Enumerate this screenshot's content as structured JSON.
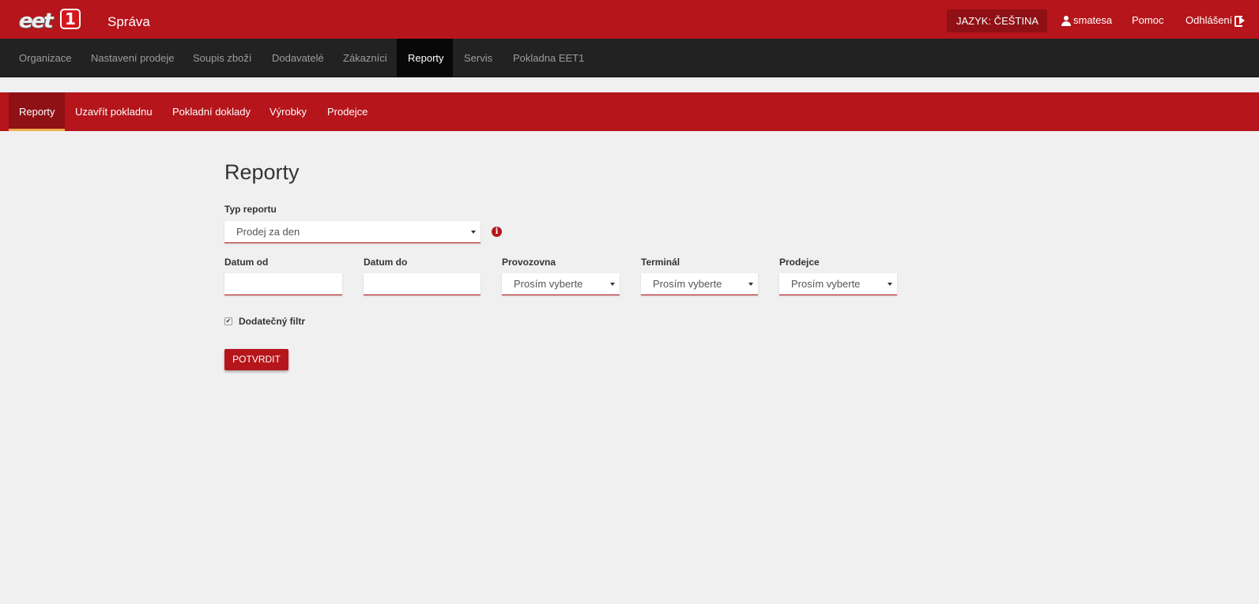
{
  "header": {
    "logo_text": "eet",
    "logo_badge": "1",
    "app_title": "Správa",
    "language_button": "JAZYK: ČEŠTINA",
    "user": "smatesa",
    "help": "Pomoc",
    "logout": "Odhlášení"
  },
  "main_nav": [
    {
      "label": "Organizace"
    },
    {
      "label": "Nastavení prodeje"
    },
    {
      "label": "Soupis zboží"
    },
    {
      "label": "Dodavatelé"
    },
    {
      "label": "Zákazníci"
    },
    {
      "label": "Reporty",
      "active": true
    },
    {
      "label": "Servis"
    },
    {
      "label": "Pokladna EET1"
    }
  ],
  "sub_nav": [
    {
      "label": "Reporty",
      "active": true
    },
    {
      "label": "Uzavřít pokladnu"
    },
    {
      "label": "Pokladní doklady"
    },
    {
      "label": "Výrobky"
    },
    {
      "label": "Prodejce"
    }
  ],
  "main": {
    "title": "Reporty",
    "report_type": {
      "label": "Typ reportu",
      "value": "Prodej za den"
    },
    "date_from": {
      "label": "Datum od",
      "value": ""
    },
    "date_to": {
      "label": "Datum do",
      "value": ""
    },
    "branch": {
      "label": "Provozovna",
      "value": "Prosím vyberte"
    },
    "terminal": {
      "label": "Terminál",
      "value": "Prosím vyberte"
    },
    "seller": {
      "label": "Prodejce",
      "value": "Prosím vyberte"
    },
    "extra_filter": {
      "label": "Dodatečný filtr",
      "checked": true,
      "check_glyph": "✔"
    },
    "submit_label": "POTVRDIT"
  },
  "colors": {
    "brand_red": "#b5151b",
    "dark_red": "#8f1015",
    "nav_dark": "#222222",
    "active_underline": "#f0ad4e"
  }
}
